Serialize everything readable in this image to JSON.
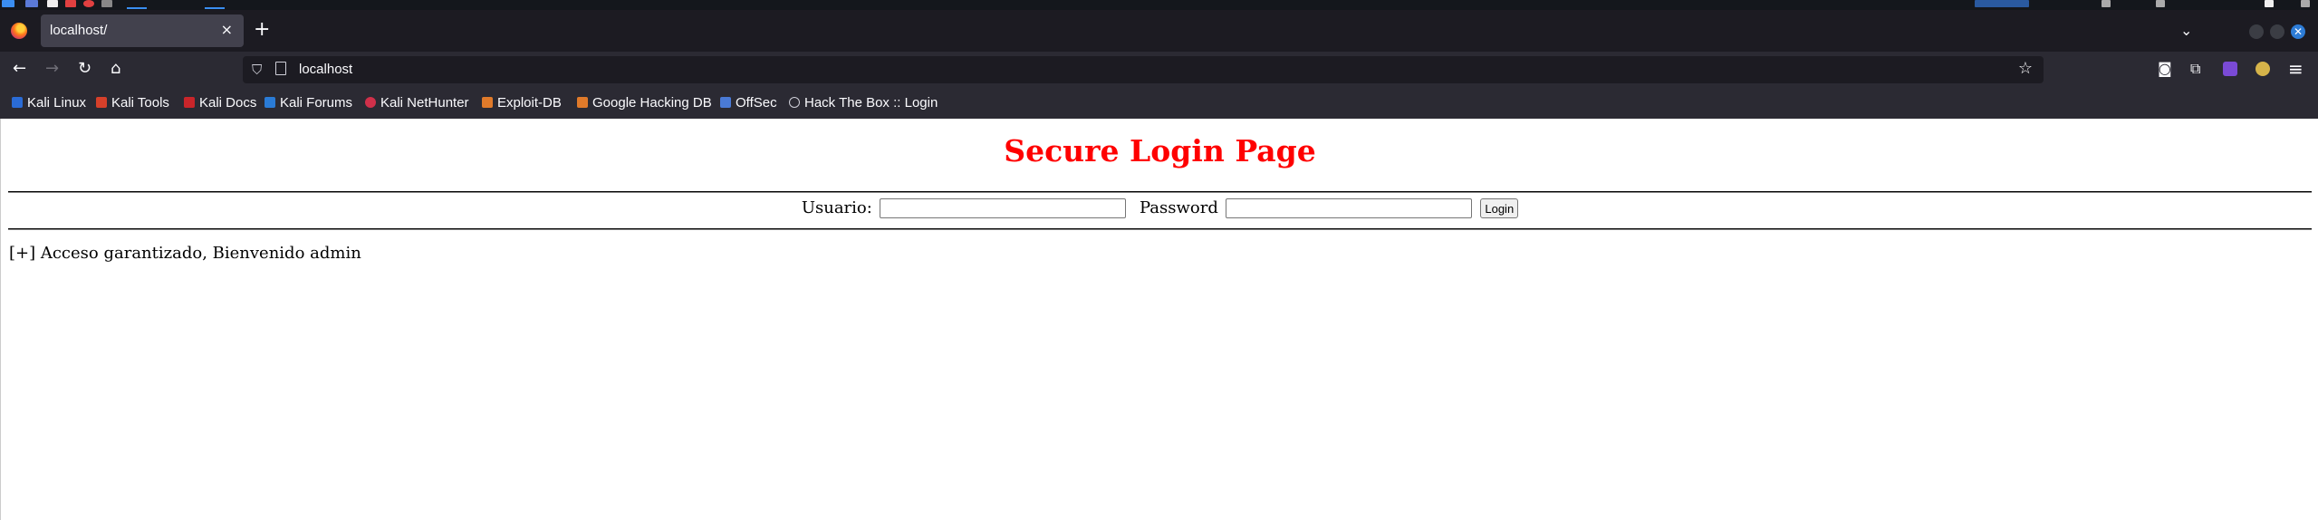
{
  "browser": {
    "tab": {
      "title": "localhost/",
      "close_glyph": "×"
    },
    "new_tab_glyph": "+",
    "tab_list_glyph": "⌄",
    "window_close_glyph": "✕",
    "url": "localhost",
    "nav": {
      "back": "←",
      "forward": "→",
      "reload": "↻",
      "home": "⌂"
    },
    "bookmark_star": "☆",
    "toolbar_icons": [
      "pocket-icon",
      "extensions-icon",
      "extension-purple-icon",
      "account-icon",
      "menu-icon"
    ],
    "toolbar_glyphs": {
      "pocket": "◙",
      "extensions": "⧉",
      "menu": "≡"
    }
  },
  "bookmarks": [
    {
      "label": "Kali Linux",
      "color": "#2a6bd6"
    },
    {
      "label": "Kali Tools",
      "color": "#d6402a"
    },
    {
      "label": "Kali Docs",
      "color": "#c9252a"
    },
    {
      "label": "Kali Forums",
      "color": "#2a7bd6"
    },
    {
      "label": "Kali NetHunter",
      "color": "#d0304a"
    },
    {
      "label": "Exploit-DB",
      "color": "#e07a2a"
    },
    {
      "label": "Google Hacking DB",
      "color": "#e07a2a"
    },
    {
      "label": "OffSec",
      "color": "#4a7ad6"
    },
    {
      "label": "Hack The Box :: Login",
      "color": "#cfcfd8"
    }
  ],
  "page": {
    "title": "Secure Login Page",
    "title_color": "#ff0000",
    "username_label": "Usuario:",
    "username_value": "",
    "password_label": "Password",
    "password_value": "",
    "login_button": "Login",
    "message": "[+] Acceso garantizado, Bienvenido admin"
  }
}
